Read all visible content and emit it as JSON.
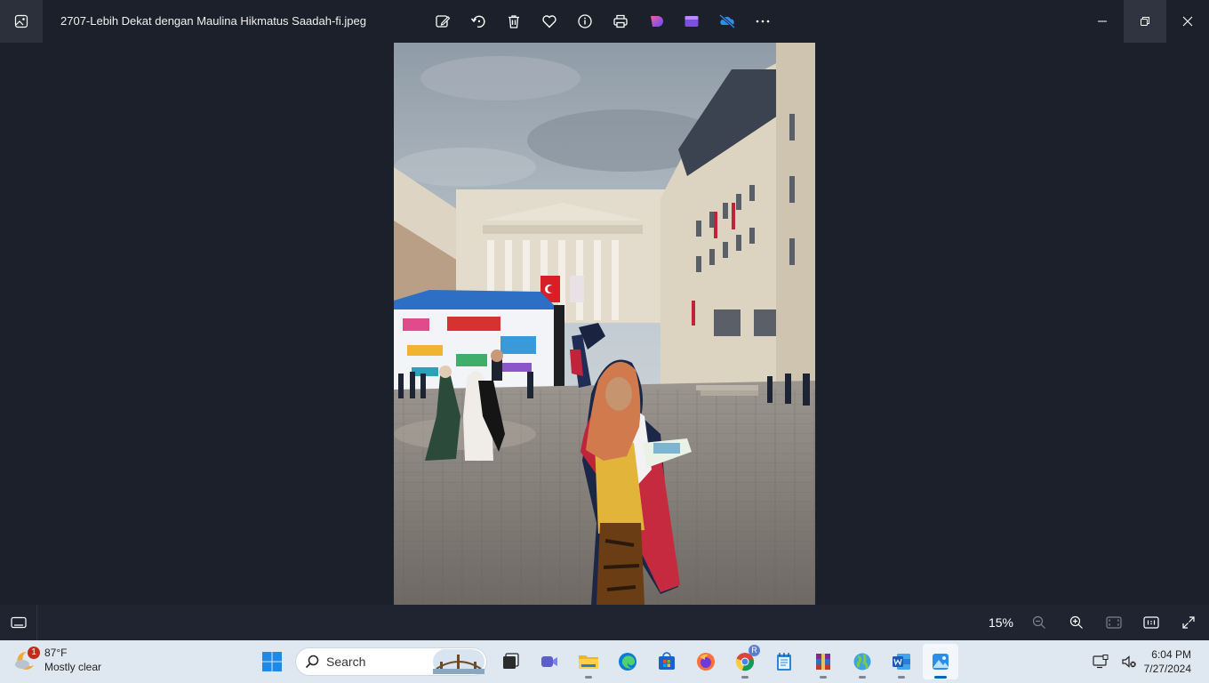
{
  "window": {
    "title": "2707-Lebih Dekat dengan Maulina Hikmatus Saadah-fi.jpeg"
  },
  "viewer": {
    "zoom": "15%"
  },
  "taskbar": {
    "weather": {
      "badge": "1",
      "temp": "87°F",
      "condition": "Mostly clear"
    },
    "search_placeholder": "Search",
    "chrome_badge": "R",
    "clock": {
      "time": "6:04 PM",
      "date": "7/27/2024"
    }
  },
  "colors": {
    "accent": "#0067c0",
    "app_bg": "#1b202b",
    "taskbar_bg": "#dfe7f1"
  }
}
